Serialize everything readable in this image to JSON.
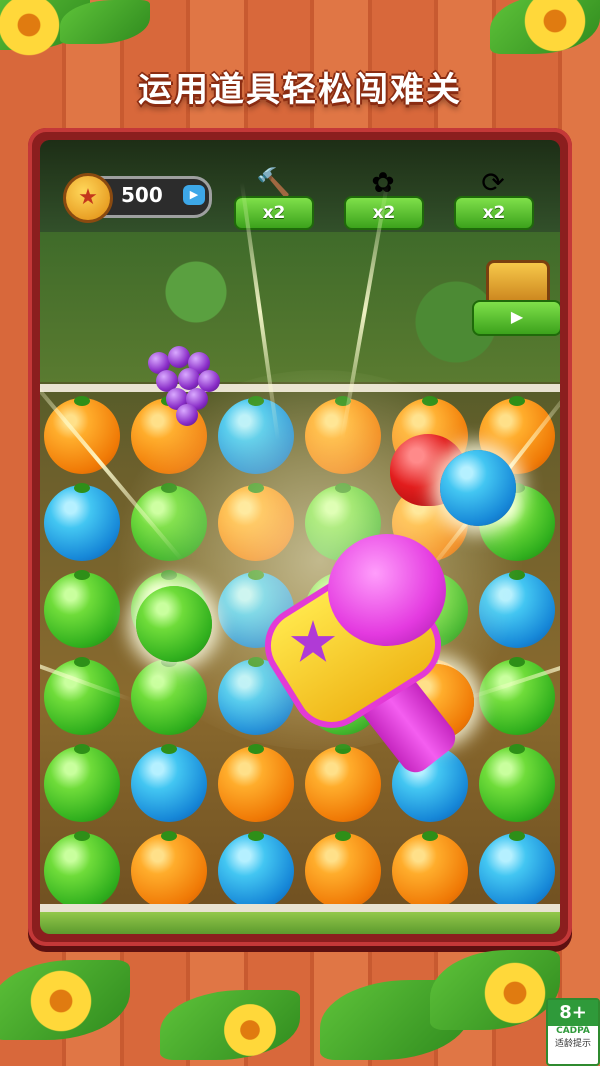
{
  "banner": {
    "title": "运用道具轻松闯难关"
  },
  "hud": {
    "coins": {
      "value": "500",
      "icon": "star-coin-icon",
      "add_icon": "video-icon"
    },
    "tools": [
      {
        "name": "hammer",
        "icon": "hammer-icon",
        "count": "x2"
      },
      {
        "name": "rainbow",
        "icon": "rainbow-flower-icon",
        "count": "x2"
      },
      {
        "name": "shuffle",
        "icon": "shuffle-icon",
        "count": "x2"
      }
    ],
    "chest_button_icon": "video-play-icon"
  },
  "board": {
    "rows": [
      [
        "orange",
        "orange",
        "blue",
        "orange",
        "orange",
        "orange"
      ],
      [
        "blue",
        "green",
        "orange",
        "green",
        "orange",
        "green"
      ],
      [
        "green",
        "green",
        "blue",
        "green",
        "green",
        "blue"
      ],
      [
        "green",
        "green",
        "blue",
        "green",
        "orange",
        "green"
      ],
      [
        "green",
        "blue",
        "orange",
        "orange",
        "blue",
        "green"
      ],
      [
        "green",
        "orange",
        "blue",
        "orange",
        "orange",
        "blue"
      ]
    ],
    "highlighted": [
      "grape",
      "apple",
      "blue",
      "green",
      "orange"
    ],
    "booster_in_use": "hammer"
  },
  "rating": {
    "age": "8+",
    "org": "CADPA",
    "label": "适龄提示"
  },
  "colors": {
    "accent_green": "#3ca21c",
    "frame_red": "#8b1e1e",
    "title_outline": "#8a2c12"
  }
}
